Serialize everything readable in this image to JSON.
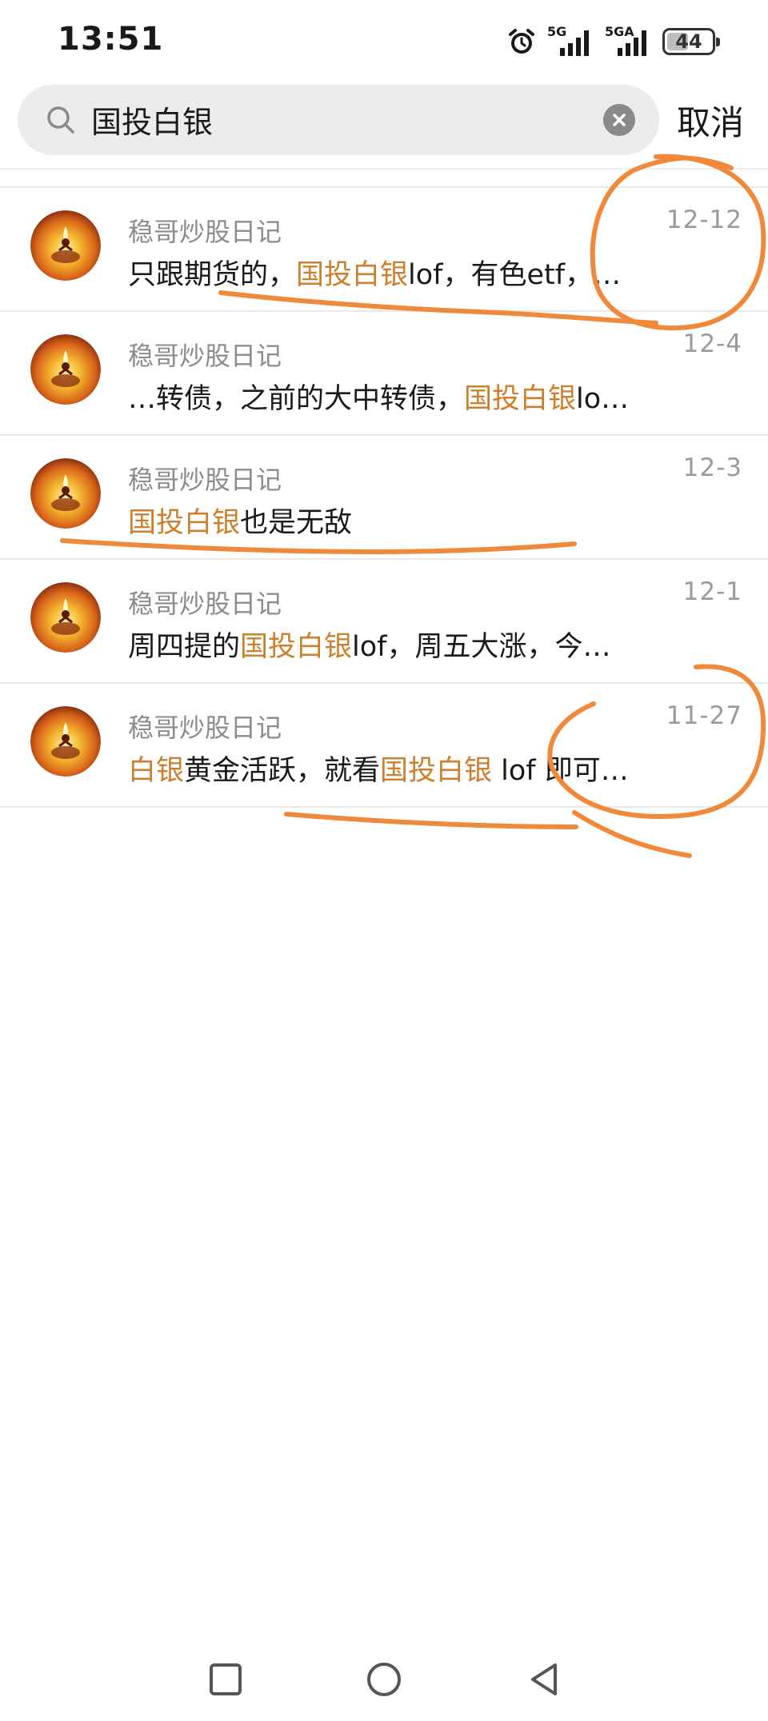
{
  "status_bar": {
    "time": "13:51",
    "icons": [
      "alarm-icon",
      "signal-5g-icon",
      "signal-5ga-icon",
      "battery-icon"
    ],
    "signal_1_label": "5G",
    "signal_2_label": "5GA",
    "battery_level": "44"
  },
  "search": {
    "query": "国投白银",
    "cancel_label": "取消"
  },
  "results": [
    {
      "author": "稳哥炒股日记",
      "date": "12-12",
      "segments": [
        "只跟期货的，",
        "国投白银",
        "lof，有色etf，…"
      ]
    },
    {
      "author": "稳哥炒股日记",
      "date": "12-4",
      "segments": [
        "…转债，之前的大中转债，",
        "国投白银",
        "lo…"
      ]
    },
    {
      "author": "稳哥炒股日记",
      "date": "12-3",
      "segments": [
        "",
        "国投白银",
        "也是无敌"
      ]
    },
    {
      "author": "稳哥炒股日记",
      "date": "12-1",
      "segments": [
        "周四提的",
        "国投白银",
        "lof，周五大涨，今…"
      ]
    },
    {
      "author": "稳哥炒股日记",
      "date": "11-27",
      "segments_multi": [
        {
          "text": "白银",
          "hl": true
        },
        {
          "text": "黄金活跃，就看",
          "hl": false
        },
        {
          "text": "国投白银",
          "hl": true
        },
        {
          "text": " lof 即可…",
          "hl": false
        }
      ]
    }
  ],
  "colors": {
    "highlight": "#cf7f2c",
    "annotation": "#f0893a",
    "search_bg": "#ececec"
  },
  "nav": {
    "icons": [
      "recents-square-icon",
      "home-circle-icon",
      "back-triangle-icon"
    ]
  }
}
